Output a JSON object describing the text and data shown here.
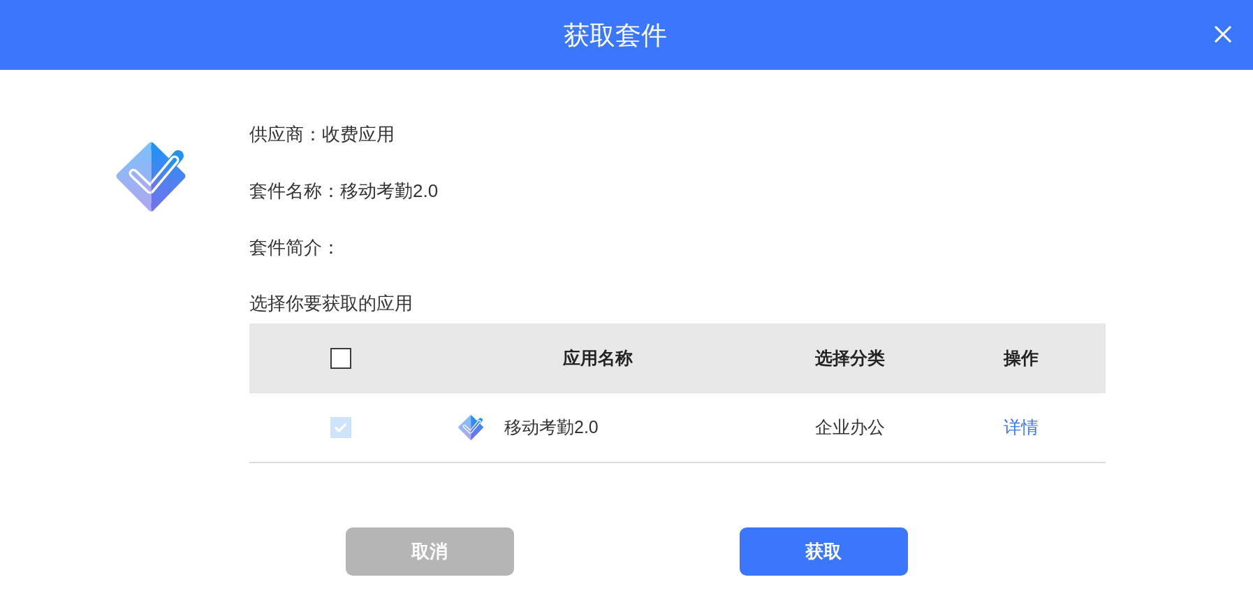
{
  "dialog": {
    "title": "获取套件"
  },
  "info_lines": [
    "供应商：收费应用",
    "套件名称：移动考勤2.0",
    "套件简介："
  ],
  "prompt": "选择你要获取的应用",
  "table": {
    "select_all": {
      "checked": false,
      "disabled": false
    },
    "columns": [
      "应用名称",
      "选择分类",
      "操作"
    ],
    "rows": [
      {
        "checked": true,
        "disabled": true,
        "name": "移动考勤2.0",
        "category": "企业办公",
        "action": "详情"
      }
    ]
  },
  "buttons": [
    {
      "label": "取消",
      "kind": "secondary"
    },
    {
      "label": "获取",
      "kind": "primary"
    }
  ]
}
